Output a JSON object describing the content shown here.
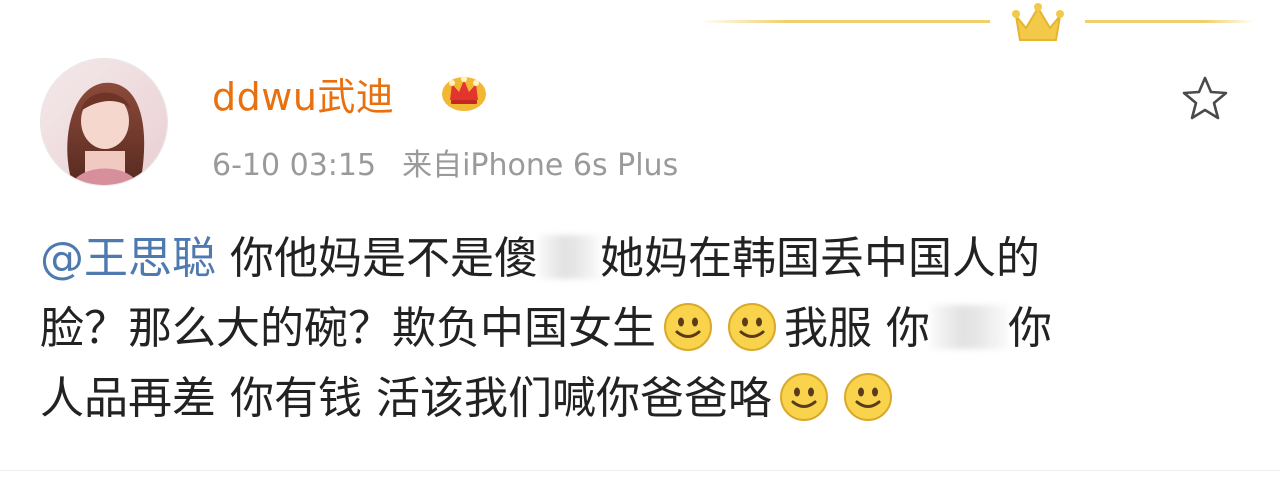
{
  "post": {
    "username": "ddwu武迪",
    "time": "6-10 03:15",
    "source": "来自iPhone 6s Plus",
    "text": {
      "mention": "@王思聪",
      "line1_a": "你他妈是不是傻",
      "line1_b": "她妈在韩国丢中国人的",
      "line2_a": "脸？那么大的碗？欺负中国女生",
      "line2_b": "我服 你",
      "line2_c": "你",
      "line3_a": "人品再差 你有钱 活该我们喊你爸爸咯"
    },
    "icons": {
      "crown": "crown-icon",
      "vip": "vip-crown-badge-icon",
      "favorite": "star-icon",
      "emoji": "smile-emoji-icon"
    },
    "colors": {
      "username": "#e9700e",
      "mention": "#4f7ab0",
      "meta": "#9a9a9a",
      "text": "#222222",
      "gold": "#f1cf6a"
    }
  }
}
